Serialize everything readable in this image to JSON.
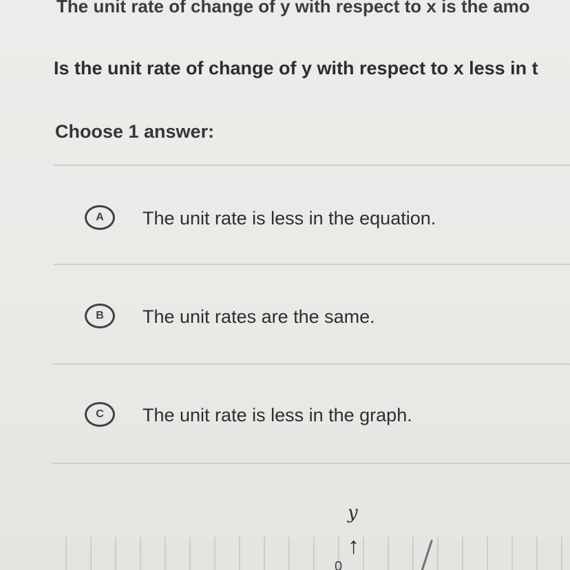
{
  "question_area": {
    "prev_text_partial": "The unit rate of change of y with respect to x is the amo",
    "question_partial": "Is the unit rate of change of y with respect to x less in t",
    "prompt": "Choose 1 answer:"
  },
  "choices": [
    {
      "letter": "A",
      "text": "The unit rate is less in the equation."
    },
    {
      "letter": "B",
      "text": "The unit rates are the same."
    },
    {
      "letter": "C",
      "text": "The unit rate is less in the graph."
    }
  ],
  "graph": {
    "y_axis_label": "y",
    "axis_number_partial": "0"
  }
}
